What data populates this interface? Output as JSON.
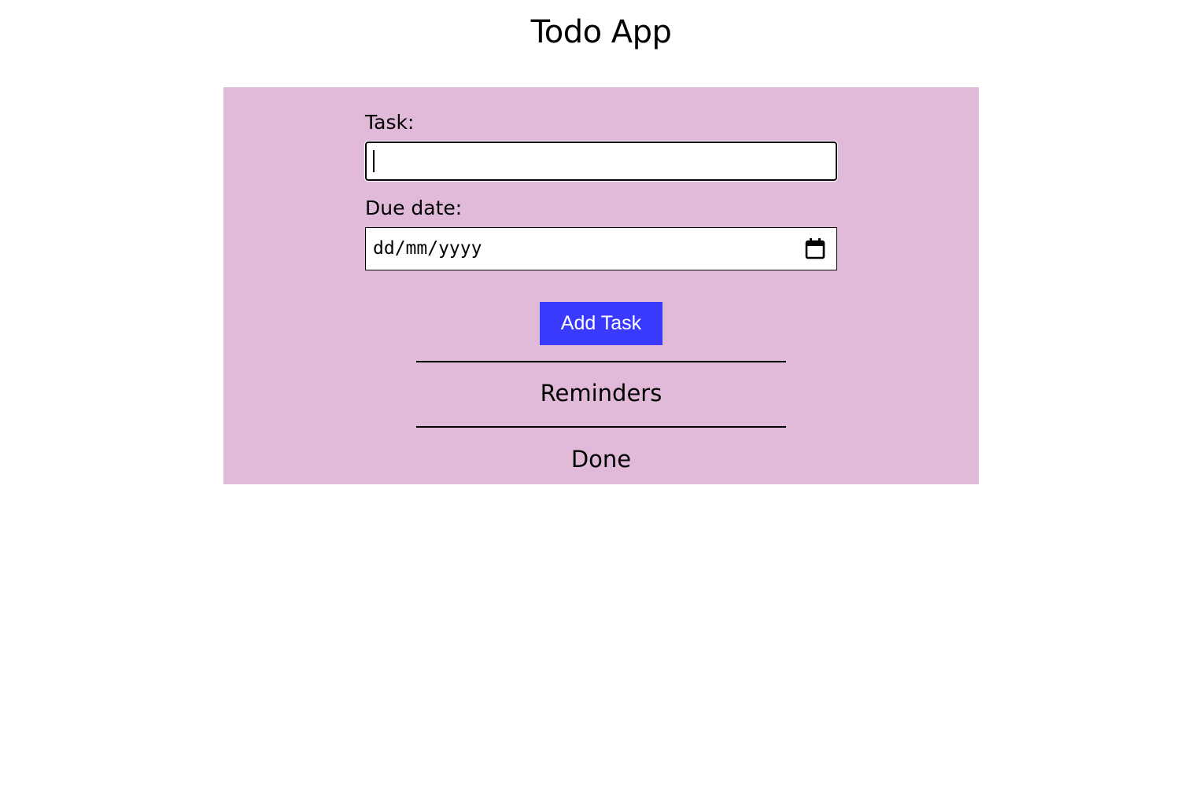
{
  "app": {
    "title": "Todo App"
  },
  "form": {
    "task_label": "Task:",
    "task_value": "",
    "due_label": "Due date:",
    "due_placeholder": "dd/mm/yyyy",
    "add_button_label": "Add Task"
  },
  "sections": {
    "reminders_title": "Reminders",
    "done_title": "Done"
  },
  "icons": {
    "date_picker": "calendar-icon"
  },
  "colors": {
    "panel_bg": "#e0bad8",
    "button_bg": "#3a3aff",
    "button_text": "#ffffff"
  }
}
